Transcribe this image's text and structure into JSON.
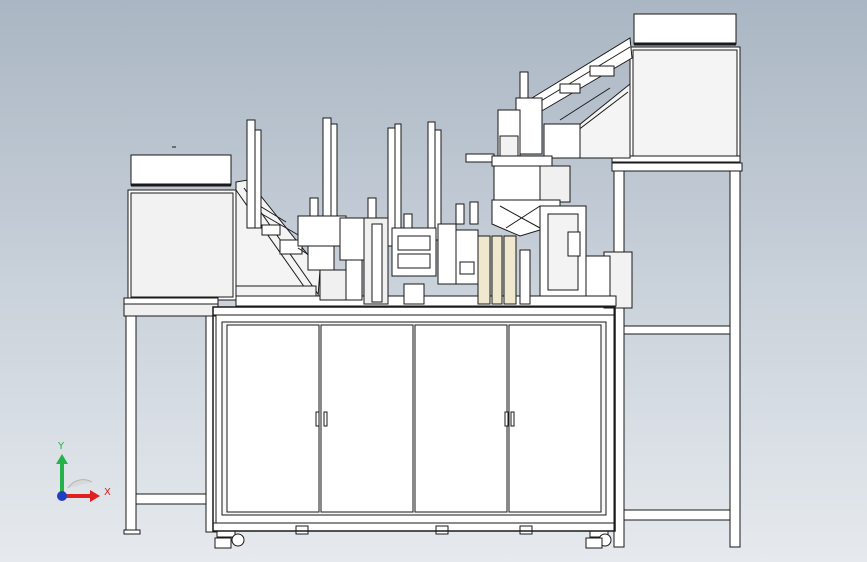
{
  "viewport": {
    "background_top": "#aab6c3",
    "background_bottom": "#e6eaee",
    "model_line_color": "#1a1a1a",
    "model_face_color": "#ffffff",
    "panel_shade_color": "#e9e9e9"
  },
  "triad": {
    "x_label": "X",
    "y_label": "Y",
    "x_color": "#e0201e",
    "y_color": "#25b24a",
    "z_color": "#1f3fbf"
  }
}
